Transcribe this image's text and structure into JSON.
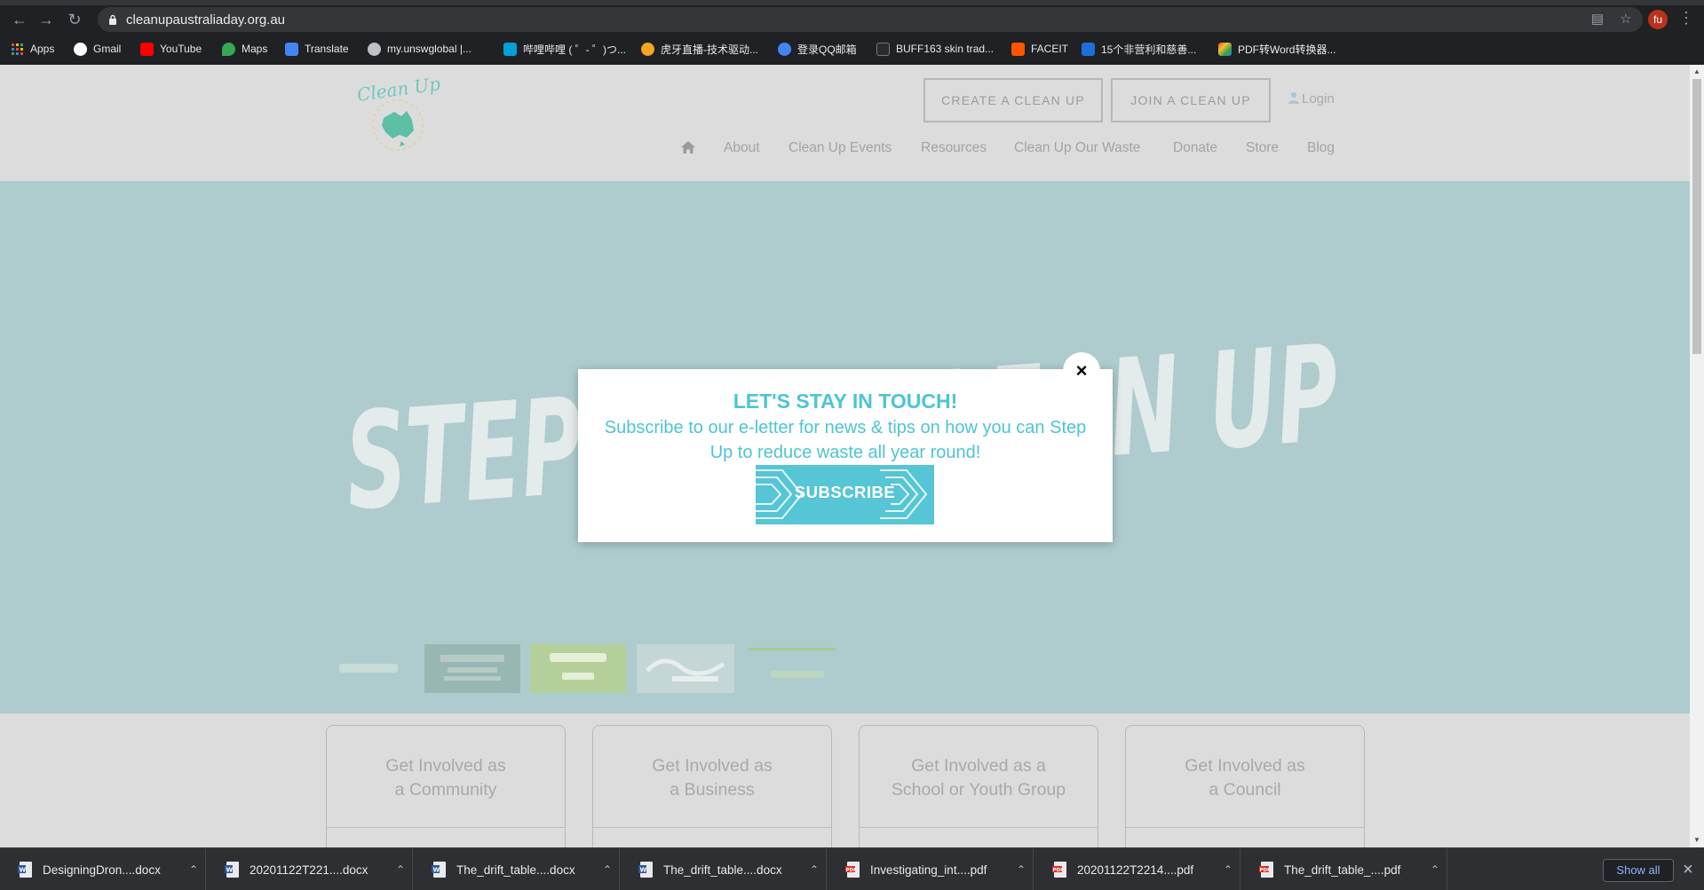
{
  "browser": {
    "url": "cleanupaustraliaday.org.au",
    "avatar_initials": "fu",
    "bookmarks": [
      {
        "label": "Apps",
        "icon": "apps-grid-icon",
        "color": "#e8453c"
      },
      {
        "label": "Gmail",
        "icon": "google-icon",
        "color": "#4285f4"
      },
      {
        "label": "YouTube",
        "icon": "youtube-icon",
        "color": "#ff0000"
      },
      {
        "label": "Maps",
        "icon": "maps-pin-icon",
        "color": "#34a853"
      },
      {
        "label": "Translate",
        "icon": "translate-icon",
        "color": "#4285f4"
      },
      {
        "label": "my.unswglobal |...",
        "icon": "globe-icon",
        "color": "#bdc1c6"
      },
      {
        "label": "哔哩哔哩 ( ゜- ゜)つ...",
        "icon": "bilibili-icon",
        "color": "#00a1d6"
      },
      {
        "label": "虎牙直播-技术驱动...",
        "icon": "huya-icon",
        "color": "#f5a623"
      },
      {
        "label": "登录QQ邮箱",
        "icon": "qq-mail-icon",
        "color": "#4285f4"
      },
      {
        "label": "BUFF163 skin trad...",
        "icon": "buff-icon",
        "color": "#2b2b2b"
      },
      {
        "label": "FACEIT",
        "icon": "faceit-icon",
        "color": "#ff5500"
      },
      {
        "label": "15个非营利和慈善...",
        "icon": "bo-icon",
        "color": "#1e6fd9"
      },
      {
        "label": "PDF转Word转换器...",
        "icon": "pdf-converter-icon",
        "color": "#e64a19"
      }
    ]
  },
  "site": {
    "logo_text": "Clean Up",
    "header_buttons": {
      "create": "CREATE A CLEAN UP",
      "join": "JOIN A CLEAN UP"
    },
    "login": "Login",
    "nav": [
      "About",
      "Clean Up Events",
      "Resources",
      "Clean Up Our Waste",
      "Donate",
      "Store",
      "Blog"
    ],
    "hero_text": "STEP UP & CLEAN UP",
    "cards": [
      {
        "line1": "Get Involved as",
        "line2": "a Community"
      },
      {
        "line1": "Get Involved as",
        "line2": "a Business"
      },
      {
        "line1": "Get Involved as a",
        "line2": "School or Youth Group"
      },
      {
        "line1": "Get Involved as",
        "line2": "a Council"
      }
    ]
  },
  "modal": {
    "title": "LET'S STAY IN TOUCH!",
    "text": "Subscribe to our e-letter for news & tips on how you can Step Up to reduce waste all year round!",
    "button": "SUBSCRIBE",
    "close": "×",
    "accent_color": "#4ec4d3"
  },
  "downloads": {
    "items": [
      {
        "name": "DesigningDron....docx",
        "type": "docx"
      },
      {
        "name": "20201122T221....docx",
        "type": "docx"
      },
      {
        "name": "The_drift_table....docx",
        "type": "docx"
      },
      {
        "name": "The_drift_table....docx",
        "type": "docx"
      },
      {
        "name": "Investigating_int....pdf",
        "type": "pdf"
      },
      {
        "name": "20201122T2214....pdf",
        "type": "pdf"
      },
      {
        "name": "The_drift_table_....pdf",
        "type": "pdf"
      }
    ],
    "show_all": "Show all"
  }
}
